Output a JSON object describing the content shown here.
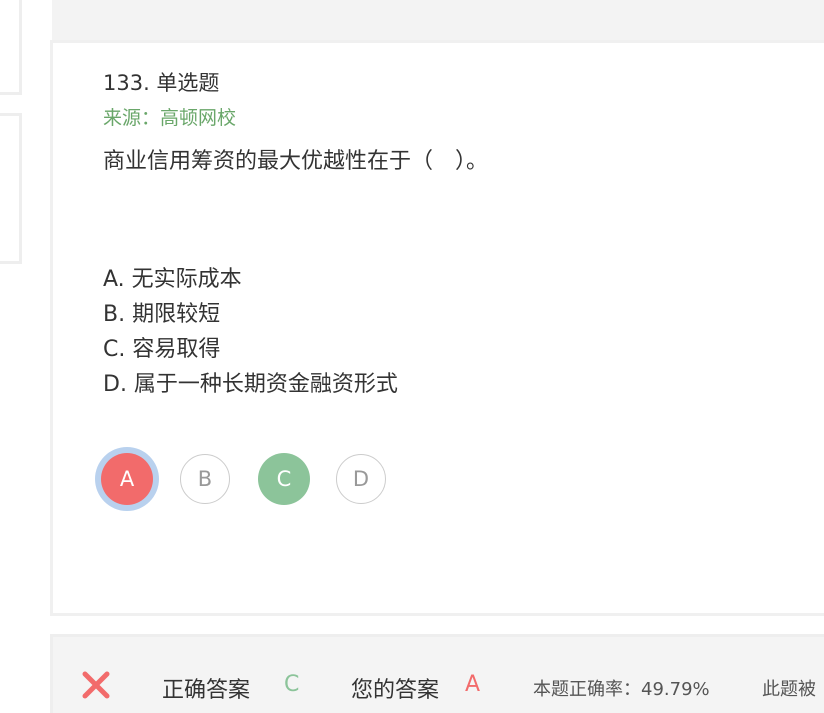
{
  "question": {
    "header": "133. 单选题",
    "source": "来源：高顿网校",
    "stem": "商业信用筹资的最大优越性在于（　）。",
    "options": [
      "A. 无实际成本",
      "B. 期限较短",
      "C. 容易取得",
      "D. 属于一种长期资金融资形式"
    ],
    "choices": [
      "A",
      "B",
      "C",
      "D"
    ],
    "selected": "A",
    "correct": "C"
  },
  "result": {
    "status_icon": "wrong-x-icon",
    "correct_label": "正确答案",
    "correct_value": "C",
    "your_label": "您的答案",
    "your_value": "A",
    "rate_text": "本题正确率：49.79%",
    "extra_text": "此题被"
  },
  "colors": {
    "wrong": "#f26b6b",
    "correct": "#8cc49a",
    "source": "#6aa76a",
    "selected_ring": "#b9d1ee"
  }
}
